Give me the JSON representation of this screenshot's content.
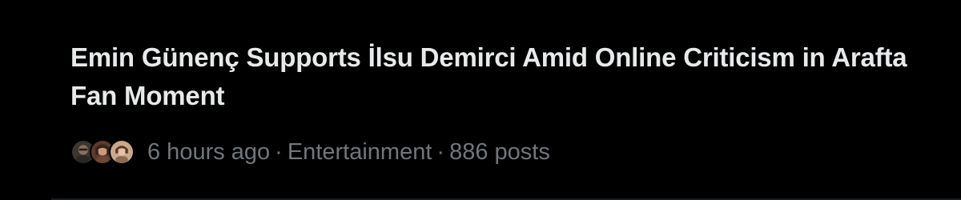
{
  "trend": {
    "headline": "Emin Günenç Supports İlsu Demirci Amid Online Criticism in Arafta Fan Moment",
    "time": "6 hours ago",
    "separator": "·",
    "category": "Entertainment",
    "posts": "886 posts"
  },
  "avatars": [
    {
      "name": "avatar-1",
      "icon": "person-photo-icon"
    },
    {
      "name": "avatar-2",
      "icon": "person-photo-icon"
    },
    {
      "name": "avatar-3",
      "icon": "person-photo-icon"
    }
  ],
  "colors": {
    "background": "#000000",
    "headline": "#e7e9ea",
    "meta": "#71767b"
  }
}
